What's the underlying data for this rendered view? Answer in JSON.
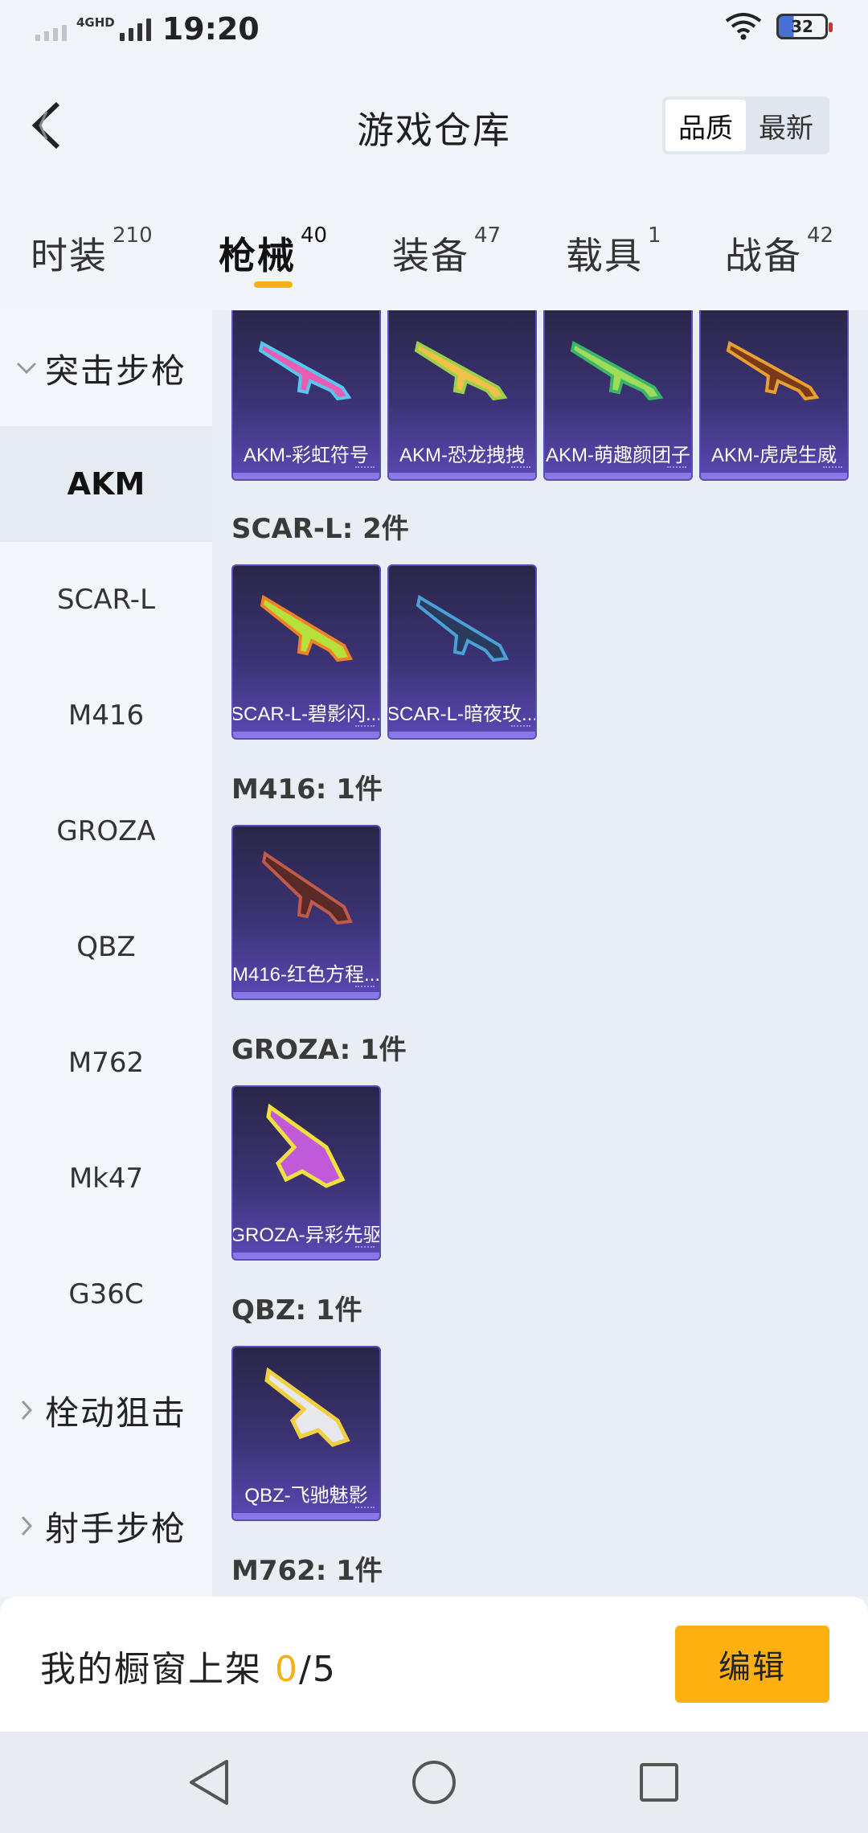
{
  "status_bar": {
    "time": "19:20",
    "network": "4GHD",
    "battery": "32"
  },
  "header": {
    "title": "游戏仓库",
    "sort_options": [
      "品质",
      "最新"
    ],
    "active_sort": "品质"
  },
  "tabs": [
    {
      "label": "时装",
      "count": "210"
    },
    {
      "label": "枪械",
      "count": "40",
      "active": true
    },
    {
      "label": "装备",
      "count": "47"
    },
    {
      "label": "载具",
      "count": "1"
    },
    {
      "label": "战备",
      "count": "42"
    }
  ],
  "sidebar": {
    "categories": [
      {
        "label": "突击步枪",
        "expanded": true
      },
      {
        "label": "栓动狙击",
        "expanded": false
      },
      {
        "label": "射手步枪",
        "expanded": false
      }
    ],
    "subitems": [
      "AKM",
      "SCAR-L",
      "M416",
      "GROZA",
      "QBZ",
      "M762",
      "Mk47",
      "G36C"
    ],
    "active_subitem": "AKM"
  },
  "groups": [
    {
      "title": "",
      "items": [
        "AKM-彩虹符号",
        "AKM-恐龙拽拽",
        "AKM-萌趣颜团子",
        "AKM-虎虎生威"
      ]
    },
    {
      "title": "SCAR-L: 2件",
      "items": [
        "SCAR-L-碧影闪...",
        "SCAR-L-暗夜玫..."
      ]
    },
    {
      "title": "M416: 1件",
      "items": [
        "M416-红色方程..."
      ]
    },
    {
      "title": "GROZA: 1件",
      "items": [
        "GROZA-异彩先驱"
      ]
    },
    {
      "title": "QBZ: 1件",
      "items": [
        "QBZ-飞驰魅影"
      ]
    },
    {
      "title": "M762: 1件",
      "items": []
    }
  ],
  "showcase": {
    "label": "我的橱窗上架 ",
    "current": "0",
    "total": "/5",
    "edit_label": "编辑"
  },
  "colors": {
    "accent": "#f5b218",
    "card_purple": "#3b3374"
  },
  "nav": {
    "icons": [
      "back-triangle-icon",
      "home-circle-icon",
      "recents-square-icon"
    ]
  }
}
